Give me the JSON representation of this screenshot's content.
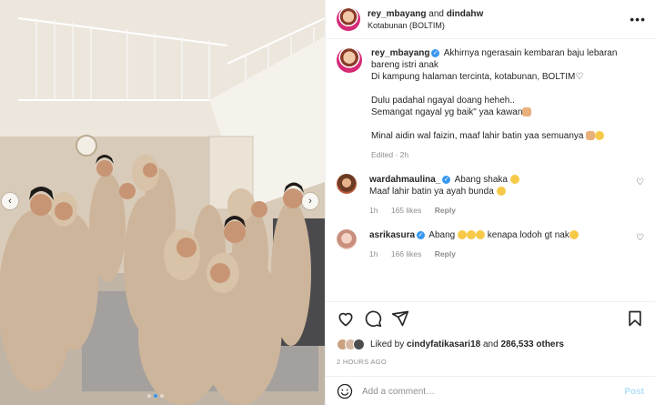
{
  "header": {
    "user1": "rey_mbayang",
    "and_text": "and",
    "user2": "dindahw",
    "location": "Kotabunan (BOLTIM)"
  },
  "caption": {
    "username": "rey_mbayang",
    "line1": "Akhirnya ngerasain kembaran baju lebaran bareng istri anak",
    "line2": "Di kampung halaman tercinta, kotabunan, BOLTIM",
    "line3": "Dulu padahal ngayal doang heheh..",
    "line4": "Semangat ngayal yg baik\" yaa kawan",
    "line5": "Minal aidin wal faizin, maaf lahir batin yaa semuanya",
    "meta": "Edited · 2h"
  },
  "comments": [
    {
      "username": "wardahmaulina_",
      "text1": "Abang shaka",
      "text2": "Maaf lahir batin ya ayah bunda",
      "time": "1h",
      "likes": "165 likes",
      "reply": "Reply"
    },
    {
      "username": "asrikasura",
      "text1": "Abang",
      "text2": "kenapa lodoh gt nak",
      "time": "1h",
      "likes": "166 likes",
      "reply": "Reply"
    }
  ],
  "likes": {
    "prefix": "Liked by",
    "user": "cindyfatikasari18",
    "middle": "and",
    "count": "286,533 others"
  },
  "timestamp": "2 HOURS AGO",
  "add_comment": {
    "placeholder": "Add a comment…",
    "post_label": "Post"
  },
  "carousel": {
    "prev_glyph": "‹",
    "next_glyph": "›"
  },
  "colors": {
    "verified": "#3897f0",
    "secondary_text": "#8e8e8e",
    "post_button": "#b2dffc"
  }
}
